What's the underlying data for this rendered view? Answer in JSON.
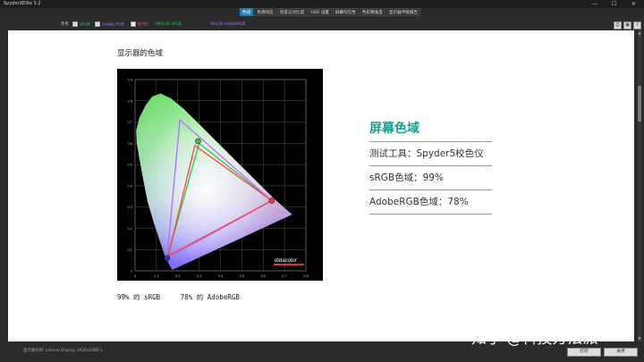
{
  "window": {
    "title": "SpyderXElite 5.2",
    "minimize_glyph": "—",
    "maximize_glyph": "☐",
    "close_glyph": "✕"
  },
  "tabs": [
    "色域",
    "色调响应",
    "亮度与对比度",
    "OSD 设置",
    "屏幕均匀性",
    "色彩精准度",
    "显示器评级报告"
  ],
  "filters": {
    "label": "参考",
    "srgb": "sRGB",
    "adobe": "Adobe RGB",
    "ntsc": "NTSC",
    "srgb_pct": "99% 的 sRGB",
    "adobe_pct": "78% 的 AdobeRGB"
  },
  "colors": {
    "srgb": "#22cc44",
    "adobe": "#b070ff",
    "ntsc": "#ff6060",
    "accent_tab": "#1f7fb7",
    "heading": "#1a9d92"
  },
  "icons": [
    "print-icon",
    "save-icon",
    "export-icon"
  ],
  "section_title": "显示器的色域",
  "summary": {
    "heading": "屏幕色域",
    "tool": "测试工具：Spyder5校色仪",
    "srgb": "sRGB色域：99%",
    "adobe": "AdobeRGB色域：78%"
  },
  "caption": "99% 的 sRGB     78% 的 AdobeRGB",
  "chart_data": {
    "type": "scatter",
    "title": "",
    "xlabel": "",
    "ylabel": "",
    "xlim": [
      0,
      0.8
    ],
    "ylim": [
      0,
      0.9
    ],
    "x_ticks": [
      "0",
      "0.1",
      "0.2",
      "0.3",
      "0.4",
      "0.5",
      "0.6",
      "0.7",
      "0.8"
    ],
    "y_ticks": [
      "0",
      "0.1",
      "0.2",
      "0.3",
      "0.4",
      "0.5",
      "0.6",
      "0.7",
      "0.8",
      "0.9"
    ],
    "grid": true,
    "brand": "datacolor",
    "spectral_locus": [
      [
        0.175,
        0.005
      ],
      [
        0.17,
        0.012
      ],
      [
        0.16,
        0.03
      ],
      [
        0.14,
        0.07
      ],
      [
        0.12,
        0.13
      ],
      [
        0.09,
        0.22
      ],
      [
        0.06,
        0.32
      ],
      [
        0.04,
        0.42
      ],
      [
        0.02,
        0.53
      ],
      [
        0.008,
        0.6
      ],
      [
        0.005,
        0.66
      ],
      [
        0.02,
        0.72
      ],
      [
        0.05,
        0.78
      ],
      [
        0.08,
        0.82
      ],
      [
        0.12,
        0.835
      ],
      [
        0.17,
        0.81
      ],
      [
        0.23,
        0.76
      ],
      [
        0.3,
        0.69
      ],
      [
        0.37,
        0.62
      ],
      [
        0.44,
        0.55
      ],
      [
        0.51,
        0.48
      ],
      [
        0.58,
        0.41
      ],
      [
        0.65,
        0.34
      ],
      [
        0.735,
        0.265
      ]
    ],
    "series": [
      {
        "name": "sRGB",
        "color": "#22cc44",
        "points": [
          [
            0.64,
            0.33
          ],
          [
            0.3,
            0.6
          ],
          [
            0.15,
            0.06
          ]
        ]
      },
      {
        "name": "Adobe RGB",
        "color": "#b070ff",
        "points": [
          [
            0.64,
            0.33
          ],
          [
            0.21,
            0.71
          ],
          [
            0.15,
            0.06
          ]
        ]
      },
      {
        "name": "NTSC",
        "color": "#ff4040",
        "points": [
          [
            0.64,
            0.33
          ],
          [
            0.28,
            0.59
          ],
          [
            0.155,
            0.07
          ]
        ]
      }
    ],
    "measured_primaries": [
      [
        0.64,
        0.33
      ],
      [
        0.295,
        0.61
      ],
      [
        0.15,
        0.06
      ]
    ]
  },
  "statusbar": {
    "display": "显示器名称: Lenovo Display 1920x1080-1",
    "print": "打印",
    "close": "关闭"
  },
  "watermark": "知乎 @科技方法派"
}
